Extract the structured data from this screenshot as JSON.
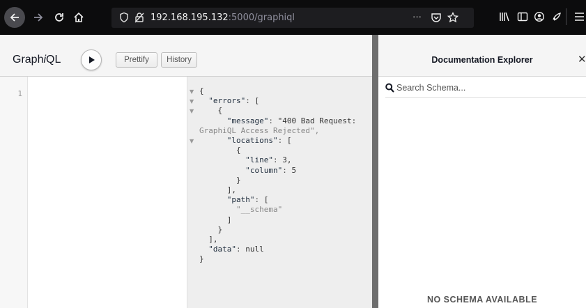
{
  "browser": {
    "url_host": "192.168.195.132",
    "url_path": ":5000/graphiql",
    "page_actions": "···"
  },
  "graphiql": {
    "title_prefix": "Graph",
    "title_italic": "i",
    "title_suffix": "QL",
    "prettify_label": "Prettify",
    "history_label": "History",
    "query_line_number": "1",
    "response_lines": [
      "{",
      "  \"errors\": [",
      "    {",
      "      \"message\": \"400 Bad Request:",
      "GraphiQL Access Rejected\",",
      "      \"locations\": [",
      "        {",
      "          \"line\": 3,",
      "          \"column\": 5",
      "        }",
      "      ],",
      "      \"path\": [",
      "        \"__schema\"",
      "      ]",
      "    }",
      "  ],",
      "  \"data\": null",
      "}"
    ]
  },
  "docs": {
    "title": "Documentation Explorer",
    "close_glyph": "✕",
    "search_placeholder": "Search Schema...",
    "empty_message": "NO SCHEMA AVAILABLE"
  }
}
